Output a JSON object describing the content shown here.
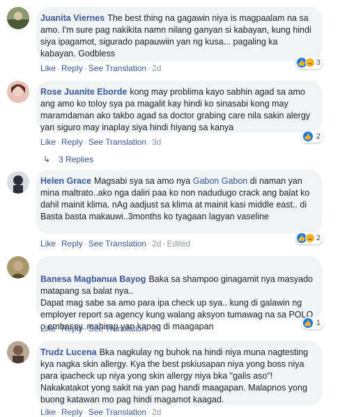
{
  "comments": [
    {
      "name": "Juanita Viernes",
      "text": "The best thing na gagawin niya is magpaalam na sa amo. I'm sure pag nakikita namn nilang ganyan si kabayan, kung hindi siya ipagamot, sigurado papauwiin yan ng kusa... pagaling ka kabayan. Godbless",
      "actions": {
        "like": "Like",
        "reply": "Reply",
        "translate": "See Translation",
        "time": "2d"
      },
      "reaction_count": "3",
      "avatar_color": "#6a7a5a"
    },
    {
      "name": "Rose Juanite Eborde",
      "text": "kong may problima kayo sabhin agad sa amo ang amo ko toloy sya pa magalit kay hindi ko sinasabi kong may maramdaman ako takbo agad sa doctor grabing care nila sakin alergy yan siguro may inaplay siya hindi hiyang sa kanya",
      "actions": {
        "like": "Like",
        "reply": "Reply",
        "translate": "See Translation",
        "time": "3d"
      },
      "reaction_count": "2",
      "replies_label": "3 Replies",
      "avatar_color": "#c98b7a"
    },
    {
      "name": "Helen Grace",
      "text_before": "Magsabi sya sa amo nya ",
      "tag": "Gabon Gabon",
      "text_after": " di naman yan mina maltrato..ako nga daliri paa ko non nadudugo crack ang balat ko dahil mainit klima. nAg aadjust sa klima at mainit kasi middle east.. di Basta basta makauwi..3months ko tyagaan lagyan vaseline",
      "actions": {
        "like": "Like",
        "reply": "Reply",
        "translate": "See Translation",
        "time": "2d",
        "edited": "Edited"
      },
      "reaction_count": "2",
      "avatar_color": "#2b2f3a"
    },
    {
      "name": "Banesa Magbanua Bayog",
      "text": "Baka sa shampoo ginagamit nya masyado matapang sa balat nya..\nDapat mag sabe sa amo para ipa check up sya.. kung di galawin ng employer report sa agency kung walang aksyon tumawag na sa POLO o embassy..mahirap yan kapag di maagapan",
      "actions": {
        "like": "Like",
        "reply": "Reply",
        "translate": "See Translation",
        "time": "2d"
      },
      "reaction_count": "1",
      "avatar_color": "#8a7a4a"
    },
    {
      "name": "Trudz Lucena",
      "text": "Bka nagkulay ng buhok na hindi niya muna nagtesting kya nagka skin allergy. Kya the best pskiusapan niya yong boss niya para ipacheck up niya yong skin allergy niya bka \"galis aso\"! Nakakatakot yong sakit na yan pag handi maagapan. Malapnos yong buong katawan mo pag hindi magamot kaagad.",
      "actions": {
        "like": "Like",
        "reply": "Reply",
        "translate": "See Translation",
        "time": "2d"
      },
      "avatar_color": "#7a6a5a"
    }
  ]
}
